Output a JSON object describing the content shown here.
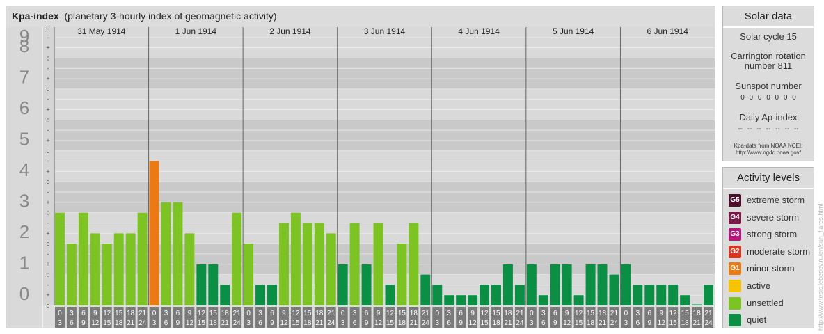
{
  "header": {
    "title": "Kpa-index",
    "subtitle": "(planetary 3-hourly index of geomagnetic activity)"
  },
  "chart_data": {
    "type": "bar",
    "title": "Kpa-index",
    "subtitle": "(planetary 3-hourly index of geomagnetic activity)",
    "ylim": [
      0,
      9
    ],
    "y_major_ticks": [
      "0",
      "1",
      "2",
      "3",
      "4",
      "5",
      "6",
      "7",
      "8",
      "9"
    ],
    "y_minor_ticks": [
      "o",
      "+",
      "-",
      "o",
      "+",
      "-",
      "o",
      "+",
      "-",
      "o",
      "+",
      "-",
      "o",
      "+",
      "-",
      "o",
      "+",
      "-",
      "o",
      "+",
      "-",
      "o",
      "+",
      "-",
      "o",
      "+",
      "-",
      "o"
    ],
    "days": [
      "31 May 1914",
      "1 Jun 1914",
      "2 Jun 1914",
      "3 Jun 1914",
      "4 Jun 1914",
      "5 Jun 1914",
      "6 Jun 1914"
    ],
    "interval_top": [
      "0",
      "3",
      "6",
      "9",
      "12",
      "15",
      "18",
      "21"
    ],
    "interval_bottom": [
      "3",
      "6",
      "9",
      "12",
      "15",
      "18",
      "21",
      "24"
    ],
    "values": [
      3.0,
      2.0,
      3.0,
      2.333,
      2.0,
      2.333,
      2.333,
      3.0,
      4.667,
      3.333,
      3.333,
      2.333,
      1.333,
      1.333,
      0.667,
      3.0,
      2.0,
      0.667,
      0.667,
      2.667,
      3.0,
      2.667,
      2.667,
      2.333,
      1.333,
      2.667,
      1.333,
      2.667,
      0.667,
      2.0,
      2.667,
      1.0,
      0.667,
      0.333,
      0.333,
      0.333,
      0.667,
      0.667,
      1.333,
      0.667,
      1.333,
      0.333,
      1.333,
      1.333,
      0.333,
      1.333,
      1.333,
      1.0,
      1.333,
      0.667,
      0.667,
      0.667,
      0.667,
      0.333,
      0.0,
      0.667
    ],
    "colors": {
      "quiet": "#0a8f45",
      "unsettled": "#7cc323",
      "active": "#f5c400",
      "minor_storm": "#ec7a14"
    }
  },
  "solar": {
    "heading": "Solar data",
    "cycle": "Solar cycle 15",
    "carrington_line1": "Carrington rotation",
    "carrington_line2": "number 811",
    "sunspot_label": "Sunspot number",
    "sunspot_values": "0 0 0 0 0 0 0",
    "ap_label": "Daily Ap-index",
    "ap_values": "-- -- -- -- -- -- --",
    "source_line1": "Kpa-data from NOAA NCEI:",
    "source_line2": "http://www.ngdc.noaa.gov/"
  },
  "levels": {
    "heading": "Activity levels",
    "items": [
      {
        "code": "G5",
        "label": "extreme storm",
        "color": "#4b0f2a"
      },
      {
        "code": "G4",
        "label": "severe storm",
        "color": "#7a1a46"
      },
      {
        "code": "G3",
        "label": "strong storm",
        "color": "#b5177a"
      },
      {
        "code": "G2",
        "label": "moderate storm",
        "color": "#d8371f"
      },
      {
        "code": "G1",
        "label": "minor storm",
        "color": "#ec7a14"
      },
      {
        "code": "",
        "label": "active",
        "color": "#f5c400"
      },
      {
        "code": "",
        "label": "unsettled",
        "color": "#7cc323"
      },
      {
        "code": "",
        "label": "quiet",
        "color": "#0a8f45"
      }
    ]
  },
  "watermark": "http://www.tesis.lebedev.ru/en/sun_flares.html"
}
